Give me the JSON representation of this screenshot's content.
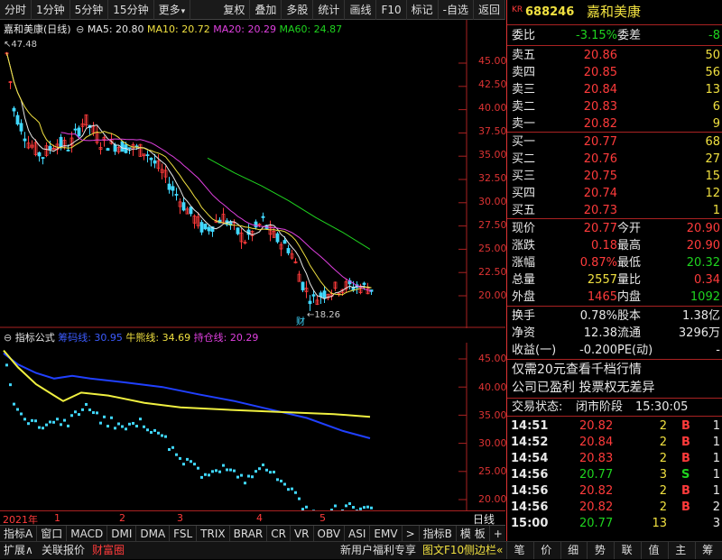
{
  "toolbar": {
    "left_items": [
      "分时",
      "1分钟",
      "5分钟",
      "15分钟",
      "更多"
    ],
    "right_items": [
      "复权",
      "叠加",
      "多股",
      "统计",
      "画线",
      "F10",
      "标记",
      "-自选",
      "返回"
    ]
  },
  "main_chart": {
    "title": "嘉和美康(日线)",
    "ma5": "MA5: 20.80",
    "ma10": "MA10: 20.72",
    "ma20": "MA20: 20.29",
    "ma60": "MA60: 24.87",
    "high_label": "47.48",
    "low_label": "18.26",
    "event_label": "财",
    "y_ticks": [
      "45.00",
      "42.50",
      "40.00",
      "37.50",
      "35.00",
      "32.50",
      "30.00",
      "27.50",
      "25.00",
      "22.50",
      "20.00"
    ]
  },
  "indicator_chart": {
    "title": "指标公式",
    "line1": "筹码线: 30.95",
    "line2": "牛熊线: 34.69",
    "line3": "持仓线: 20.29",
    "y_ticks": [
      "45.00",
      "40.00",
      "35.00",
      "30.00",
      "25.00",
      "20.00"
    ]
  },
  "x_axis": {
    "labels": [
      "2021年",
      "1",
      "2",
      "3",
      "4",
      "5"
    ],
    "period": "日线"
  },
  "tabs": [
    "指标A",
    "窗口",
    "MACD",
    "DMI",
    "DMA",
    "FSL",
    "TRIX",
    "BRAR",
    "CR",
    "VR",
    "OBV",
    "ASI",
    "EMV",
    ">",
    "指标B",
    "模 板",
    "+",
    "-"
  ],
  "status_bar": {
    "left": [
      "扩展∧",
      "关联报价",
      "财富圈"
    ],
    "middle": "新用户福利专享",
    "f10": "图文F10",
    "sidebar": "侧边栏",
    "nav": [
      "笔",
      "价",
      "细",
      "势",
      "联",
      "值",
      "主",
      "筹"
    ]
  },
  "quote": {
    "code": "688246",
    "name": "嘉和美康",
    "badge": "KR",
    "weibi_label": "委比",
    "weibi": "-3.15%",
    "weicha_label": "委差",
    "weicha": "-8",
    "asks": [
      {
        "label": "卖五",
        "price": "20.86",
        "vol": "50"
      },
      {
        "label": "卖四",
        "price": "20.85",
        "vol": "56"
      },
      {
        "label": "卖三",
        "price": "20.84",
        "vol": "13"
      },
      {
        "label": "卖二",
        "price": "20.83",
        "vol": "6"
      },
      {
        "label": "卖一",
        "price": "20.82",
        "vol": "9"
      }
    ],
    "bids": [
      {
        "label": "买一",
        "price": "20.77",
        "vol": "68"
      },
      {
        "label": "买二",
        "price": "20.76",
        "vol": "27"
      },
      {
        "label": "买三",
        "price": "20.75",
        "vol": "15"
      },
      {
        "label": "买四",
        "price": "20.74",
        "vol": "12"
      },
      {
        "label": "买五",
        "price": "20.73",
        "vol": "1"
      }
    ],
    "stats": [
      {
        "l1": "现价",
        "v1": "20.77",
        "l2": "今开",
        "v2": "20.90"
      },
      {
        "l1": "涨跌",
        "v1": "0.18",
        "l2": "最高",
        "v2": "20.90"
      },
      {
        "l1": "涨幅",
        "v1": "0.87%",
        "l2": "最低",
        "v2": "20.32"
      },
      {
        "l1": "总量",
        "v1": "2557",
        "l2": "量比",
        "v2": "0.34"
      },
      {
        "l1": "外盘",
        "v1": "1465",
        "l2": "内盘",
        "v2": "1092"
      }
    ],
    "finance": [
      {
        "l1": "换手",
        "v1": "0.78%",
        "l2": "股本",
        "v2": "1.38亿"
      },
      {
        "l1": "净资",
        "v1": "12.38",
        "l2": "流通",
        "v2": "3296万"
      },
      {
        "l1": "收益(一)",
        "v1": "-0.200",
        "l2": "PE(动)",
        "v2": "-"
      }
    ],
    "promo": "仅需20元查看千档行情",
    "info": "公司已盈利 投票权无差异",
    "trade_state_label": "交易状态:",
    "trade_state": "闭市阶段",
    "trade_time": "15:30:05",
    "ticks": [
      {
        "time": "14:51",
        "price": "20.82",
        "vol": "2",
        "side": "B",
        "n": "1"
      },
      {
        "time": "14:52",
        "price": "20.84",
        "vol": "2",
        "side": "B",
        "n": "1"
      },
      {
        "time": "14:54",
        "price": "20.83",
        "vol": "2",
        "side": "B",
        "n": "1"
      },
      {
        "time": "14:56",
        "price": "20.77",
        "vol": "3",
        "side": "S",
        "n": "1"
      },
      {
        "time": "14:56",
        "price": "20.82",
        "vol": "2",
        "side": "B",
        "n": "1"
      },
      {
        "time": "14:56",
        "price": "20.82",
        "vol": "2",
        "side": "B",
        "n": "2"
      },
      {
        "time": "15:00",
        "price": "20.77",
        "vol": "13",
        "side": "",
        "n": "3"
      }
    ]
  }
}
